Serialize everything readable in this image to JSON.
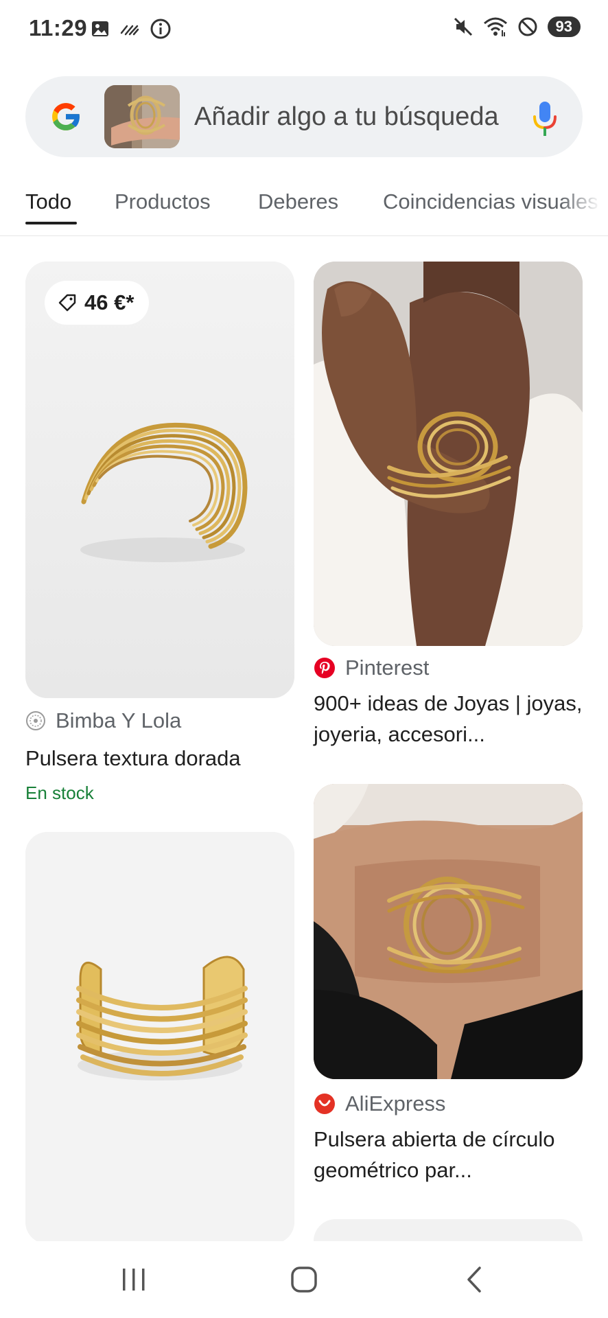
{
  "status_bar": {
    "time": "11:29",
    "battery": "93",
    "left_icons": [
      "image-icon",
      "hatch-icon",
      "info-icon"
    ],
    "right_icons": [
      "mute-icon",
      "wifi-icon",
      "do-not-disturb-icon"
    ]
  },
  "search": {
    "placeholder": "Añadir algo a tu búsqueda",
    "logo": "google-g-logo",
    "mic_icon": "mic-icon"
  },
  "tabs": [
    {
      "label": "Todo",
      "active": true
    },
    {
      "label": "Productos",
      "active": false
    },
    {
      "label": "Deberes",
      "active": false
    },
    {
      "label": "Coincidencias visuales",
      "active": false
    }
  ],
  "results": {
    "r1": {
      "price": "46 €*",
      "source": "Bimba Y Lola",
      "title": "Pulsera textura dorada",
      "stock": "En stock"
    },
    "r2": {
      "source": "Pinterest",
      "title": "900+ ideas de Joyas | joyas, joyeria, accesori..."
    },
    "r3": {
      "source": "AliExpress",
      "title": "Pulsera abierta de círculo geométrico par..."
    }
  },
  "colors": {
    "stock_green": "#188038",
    "pinterest_red": "#e60023",
    "aliexpress_red": "#e43225",
    "search_bg": "#eff1f3"
  },
  "nav": [
    "recents-icon",
    "home-icon",
    "back-icon"
  ]
}
